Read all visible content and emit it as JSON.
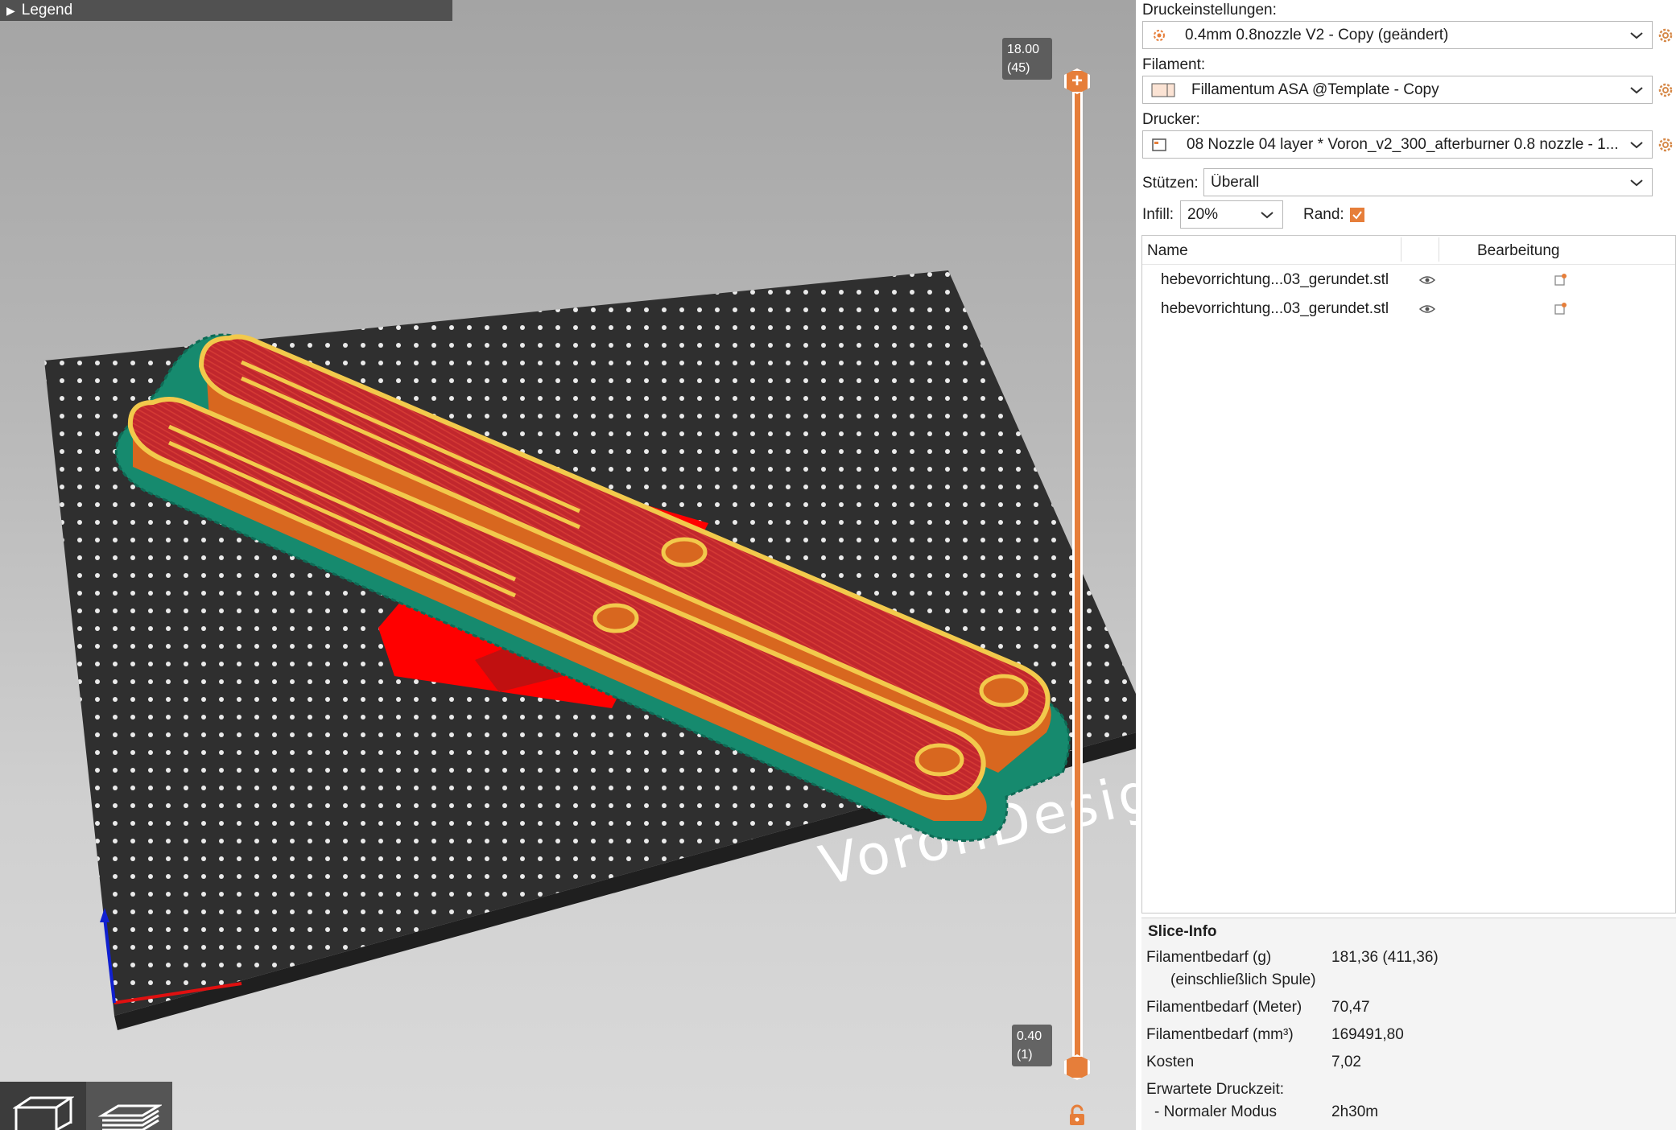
{
  "viewport": {
    "legend_label": "Legend",
    "layer_top": {
      "height": "18.00",
      "layer": "(45)"
    },
    "layer_bottom": {
      "height": "0.40",
      "layer": "(1)"
    },
    "bed_brand_text": "VoronDesign",
    "icons": [
      "expand-triangle-icon",
      "plus-icon",
      "lock-icon",
      "3d-view-icon",
      "layers-view-icon"
    ]
  },
  "panel": {
    "print_settings": {
      "label": "Druckeinstellungen:",
      "value": "0.4mm 0.8nozzle V2 - Copy (geändert)"
    },
    "filament": {
      "label": "Filament:",
      "value": "Fillamentum ASA @Template - Copy",
      "swatch_color": "#fbe3d4"
    },
    "printer": {
      "label": "Drucker:",
      "value": "08 Nozzle 04 layer * Voron_v2_300_afterburner 0.8 nozzle - 1..."
    },
    "supports": {
      "label": "Stützen:",
      "value": "Überall"
    },
    "infill": {
      "label": "Infill:",
      "value": "20%"
    },
    "brim": {
      "label": "Rand:",
      "checked": true
    },
    "objects": {
      "col_name": "Name",
      "col_edit": "Bearbeitung",
      "rows": [
        {
          "name": "hebevorrichtung...03_gerundet.stl"
        },
        {
          "name": "hebevorrichtung...03_gerundet.stl"
        }
      ]
    },
    "slice_info": {
      "title": "Slice-Info",
      "rows": [
        {
          "key": "Filamentbedarf (g)",
          "value": "181,36 (411,36)"
        },
        {
          "key": "(einschließlich Spule)",
          "value": ""
        },
        {
          "key": "Filamentbedarf (Meter)",
          "value": "70,47"
        },
        {
          "key": "Filamentbedarf (mm³)",
          "value": "169491,80"
        },
        {
          "key": "Kosten",
          "value": "7,02"
        },
        {
          "key": "Erwartete Druckzeit:",
          "value": ""
        },
        {
          "key": "- Normaler Modus",
          "value": "2h30m"
        }
      ]
    }
  },
  "colors": {
    "accent": "#e67e3a",
    "perimeter": "#f2c94c",
    "infill": "#c1272d",
    "brim": "#168a6e",
    "support": "#ff0000",
    "bed": "#2f2f2f"
  }
}
